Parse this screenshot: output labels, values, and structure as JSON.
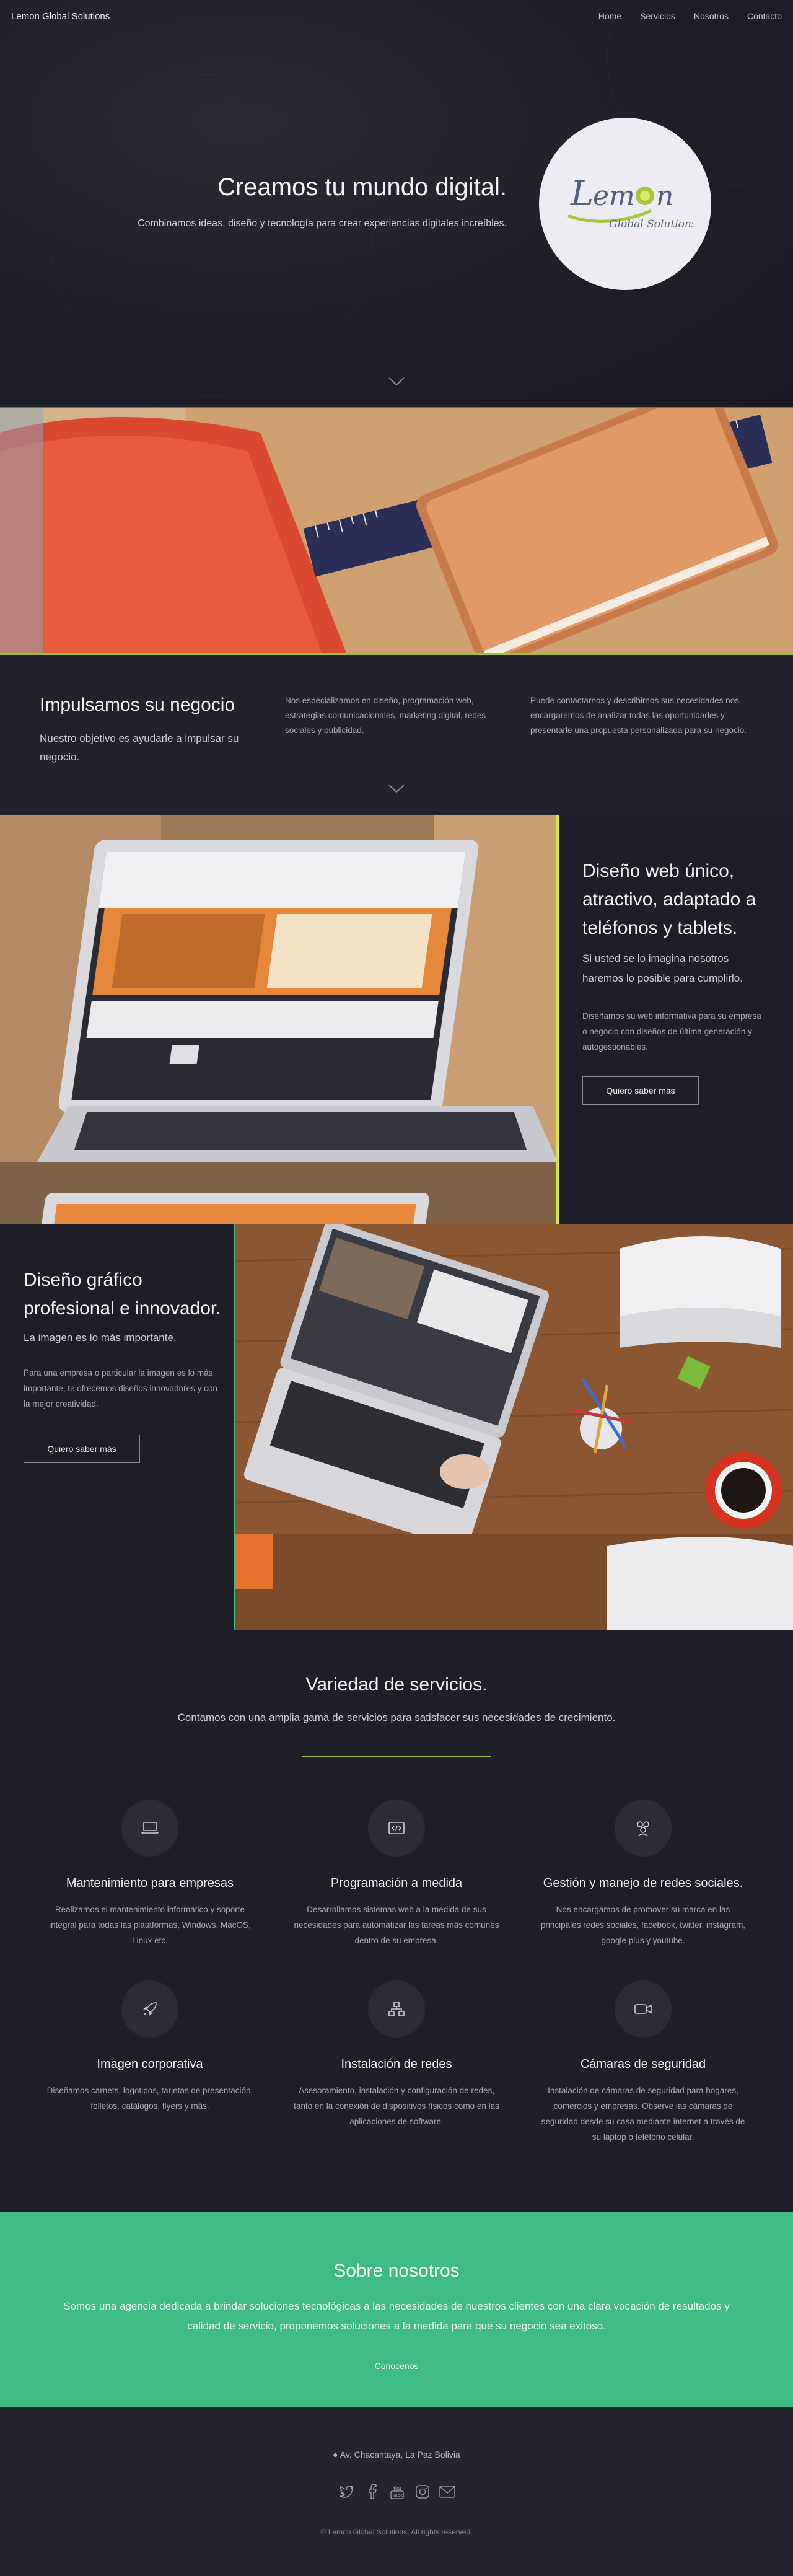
{
  "nav": {
    "brand": "Lemon Global Solutions",
    "links": [
      "Home",
      "Servicios",
      "Nosotros",
      "Contacto"
    ]
  },
  "hero": {
    "title": "Creamos tu mundo digital.",
    "subtitle": "Combinamos ideas, diseño y tecnología para crear experiencias digitales increíbles.",
    "logo_word": "Lemon",
    "logo_tagline": "Global Solutions"
  },
  "impulse": {
    "title": "Impulsamos su negocio",
    "subtitle": "Nuestro objetivo es ayudarle a impulsar su negocio.",
    "col1": "Nos especializamos en diseño, programación web, estrategias comunicacionales, marketing digital, redes sociales y publicidad.",
    "col2": "Puede contactarnos y describirnos sus necesidades nos encargaremos de analizar todas las oportunidades y presentarle una propuesta personalizada para su negocio."
  },
  "web": {
    "title": "Diseño web único, atractivo, adaptado a teléfonos y tablets.",
    "subtitle": "Si usted se lo imagina nosotros haremos lo posible para cumplirlo.",
    "body": "Diseñamos su web informativa para su empresa o negocio con diseños de última generación y autogestionables.",
    "button": "Quiero saber más"
  },
  "graf": {
    "title": "Diseño gráfico profesional e innovador.",
    "subtitle": "La imagen es lo más importante.",
    "body": "Para una empresa o particular la imagen es lo más importante, te ofrecemos diseños innovadores y con la mejor creatividad.",
    "button": "Quiero saber más"
  },
  "services": {
    "title": "Variedad de servicios.",
    "subtitle": "Contamos con una amplia gama de servicios para satisfacer sus necesidades de crecimiento.",
    "items": [
      {
        "icon": "laptop-icon",
        "name": "Mantenimiento para empresas",
        "desc": "Realizamos el mantenimiento informático y soporte integral para todas las plataformas, Windows, MacOS, Linux etc."
      },
      {
        "icon": "code-icon",
        "name": "Programación a medida",
        "desc": "Desarrollamos sistemas web a la medida de sus necesidades para automatizar las tareas más comunes dentro de su empresa."
      },
      {
        "icon": "users-icon",
        "name": "Gestión y manejo de redes sociales.",
        "desc": "Nos encargamos de promover su marca en las principales redes sociales, facebook, twitter, instagram, google plus y youtube."
      },
      {
        "icon": "rocket-icon",
        "name": "Imagen corporativa",
        "desc": "Diseñamos carnets, logotipos, tarjetas de presentación, folletos, catálogos, flyers y más."
      },
      {
        "icon": "network-icon",
        "name": "Instalación de redes",
        "desc": "Asesoramiento, instalación y configuración de redes, tanto en la conexión de dispositivos físicos como en las aplicaciones de software."
      },
      {
        "icon": "camera-icon",
        "name": "Cámaras de seguridad",
        "desc": "Instalación de cámaras de seguridad para hogares, comercios y empresas. Observe las cámaras de seguridad desde su casa mediante internet a través de su laptop o teléfono celular."
      }
    ]
  },
  "about": {
    "title": "Sobre nosotros",
    "text": "Somos una agencia dedicada a brindar soluciones tecnológicas a las necesidades de nuestros clientes con una clara vocación de resultados y calidad de servicio, proponemos soluciones a la medida para que su negocio sea exitoso.",
    "button": "Conocenos"
  },
  "footer": {
    "address": "Av. Chacantaya, La Paz Bolivia",
    "socials": [
      "twitter-icon",
      "facebook-icon",
      "youtube-icon",
      "instagram-icon",
      "mail-icon"
    ],
    "copyright": "© Lemon Global Solutions. All rights reserved."
  },
  "colors": {
    "accent_green": "#9ec13a",
    "accent_yellow": "#d8e63a",
    "accent_teal": "#3bbd7e",
    "about_bg": "#3ebc82",
    "dark_bg": "#1f1f29"
  }
}
